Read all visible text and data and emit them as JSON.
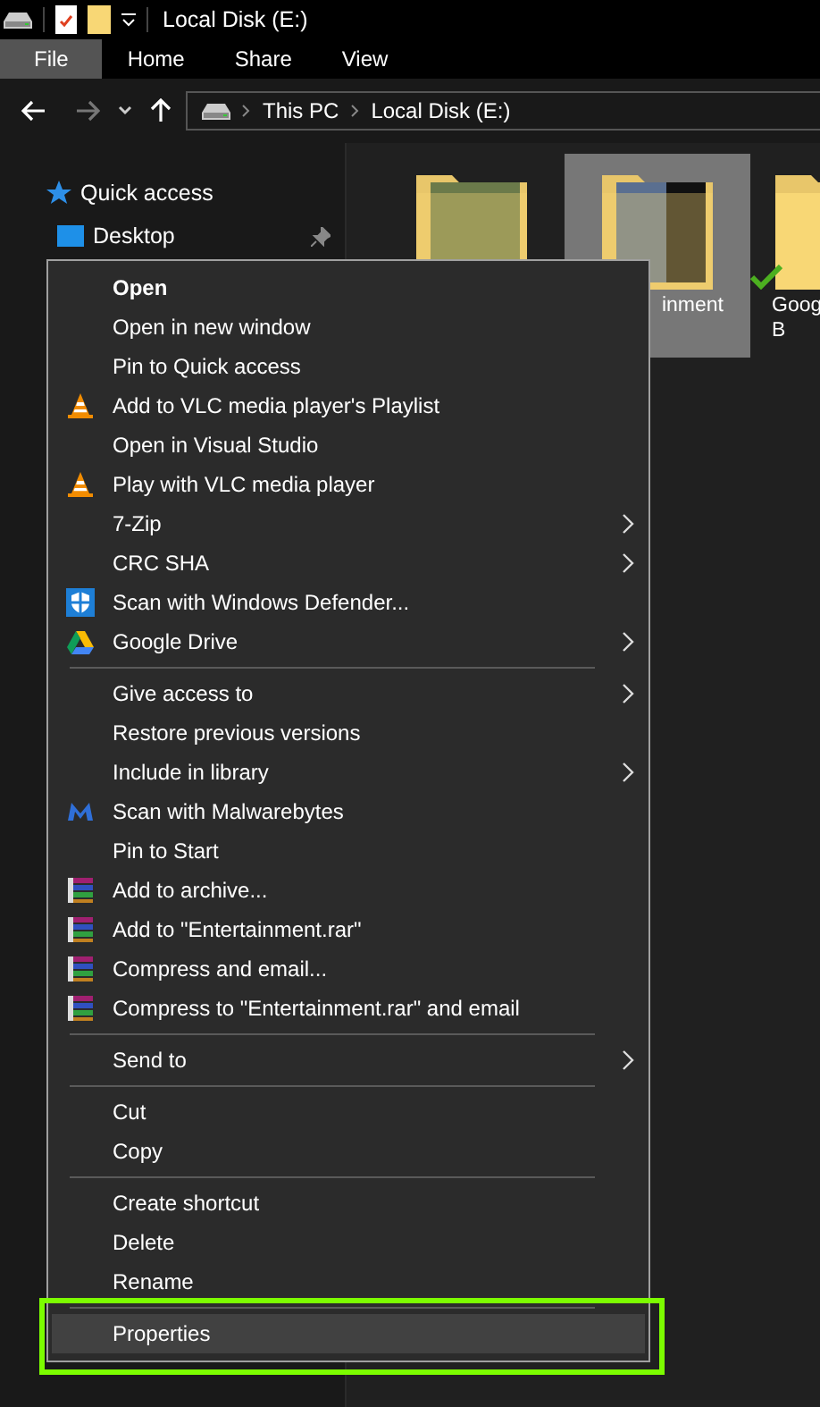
{
  "title_bar": {
    "title": "Local Disk (E:)"
  },
  "ribbon": {
    "tabs": [
      {
        "label": "File",
        "selected": true
      },
      {
        "label": "Home",
        "selected": false
      },
      {
        "label": "Share",
        "selected": false
      },
      {
        "label": "View",
        "selected": false
      }
    ]
  },
  "address_bar": {
    "path": [
      "This PC",
      "Local Disk (E:)"
    ]
  },
  "nav_pane": {
    "items": [
      {
        "label": "Quick access",
        "kind": "star",
        "pinned": false
      },
      {
        "label": "Desktop",
        "kind": "desktop",
        "pinned": true
      }
    ]
  },
  "files": [
    {
      "kind": "thumbnail",
      "selected": false
    },
    {
      "kind": "thumbnail2",
      "label": [
        "inment"
      ],
      "selected": true
    },
    {
      "kind": "folder",
      "label": [
        "Goog",
        "B"
      ],
      "selected": false,
      "synced": true
    }
  ],
  "context_menu": {
    "groups": [
      {
        "items": [
          {
            "label": "Open",
            "kind": "plain",
            "default": true,
            "submenu": false,
            "selected": false
          },
          {
            "label": "Open in new window",
            "kind": "plain",
            "default": false,
            "submenu": false,
            "selected": false
          },
          {
            "label": "Pin to Quick access",
            "kind": "plain",
            "default": false,
            "submenu": false,
            "selected": false
          },
          {
            "label": "Add to VLC media player's Playlist",
            "kind": "vlc",
            "default": false,
            "submenu": false,
            "selected": false
          },
          {
            "label": "Open in Visual Studio",
            "kind": "plain",
            "default": false,
            "submenu": false,
            "selected": false
          },
          {
            "label": "Play with VLC media player",
            "kind": "vlc",
            "default": false,
            "submenu": false,
            "selected": false
          },
          {
            "label": "7-Zip",
            "kind": "plain",
            "default": false,
            "submenu": true,
            "selected": false
          },
          {
            "label": "CRC SHA",
            "kind": "plain",
            "default": false,
            "submenu": true,
            "selected": false
          },
          {
            "label": "Scan with Windows Defender...",
            "kind": "defender",
            "default": false,
            "submenu": false,
            "selected": false
          },
          {
            "label": "Google Drive",
            "kind": "drive",
            "default": false,
            "submenu": true,
            "selected": false
          }
        ]
      },
      {
        "items": [
          {
            "label": "Give access to",
            "kind": "plain",
            "default": false,
            "submenu": true,
            "selected": false
          },
          {
            "label": "Restore previous versions",
            "kind": "plain",
            "default": false,
            "submenu": false,
            "selected": false
          },
          {
            "label": "Include in library",
            "kind": "plain",
            "default": false,
            "submenu": true,
            "selected": false
          },
          {
            "label": "Scan with Malwarebytes",
            "kind": "malwarebytes",
            "default": false,
            "submenu": false,
            "selected": false
          },
          {
            "label": "Pin to Start",
            "kind": "plain",
            "default": false,
            "submenu": false,
            "selected": false
          },
          {
            "label": "Add to archive...",
            "kind": "winrar",
            "default": false,
            "submenu": false,
            "selected": false
          },
          {
            "label": "Add to \"Entertainment.rar\"",
            "kind": "winrar",
            "default": false,
            "submenu": false,
            "selected": false
          },
          {
            "label": "Compress and email...",
            "kind": "winrar",
            "default": false,
            "submenu": false,
            "selected": false
          },
          {
            "label": "Compress to \"Entertainment.rar\" and email",
            "kind": "winrar",
            "default": false,
            "submenu": false,
            "selected": false
          }
        ]
      },
      {
        "items": [
          {
            "label": "Send to",
            "kind": "plain",
            "default": false,
            "submenu": true,
            "selected": false
          }
        ]
      },
      {
        "items": [
          {
            "label": "Cut",
            "kind": "plain",
            "default": false,
            "submenu": false,
            "selected": false
          },
          {
            "label": "Copy",
            "kind": "plain",
            "default": false,
            "submenu": false,
            "selected": false
          }
        ]
      },
      {
        "items": [
          {
            "label": "Create shortcut",
            "kind": "plain",
            "default": false,
            "submenu": false,
            "selected": false
          },
          {
            "label": "Delete",
            "kind": "plain",
            "default": false,
            "submenu": false,
            "selected": false
          },
          {
            "label": "Rename",
            "kind": "plain",
            "default": false,
            "submenu": false,
            "selected": false
          }
        ]
      },
      {
        "items": [
          {
            "label": "Properties",
            "kind": "plain",
            "default": false,
            "submenu": false,
            "selected": true
          }
        ]
      }
    ]
  }
}
